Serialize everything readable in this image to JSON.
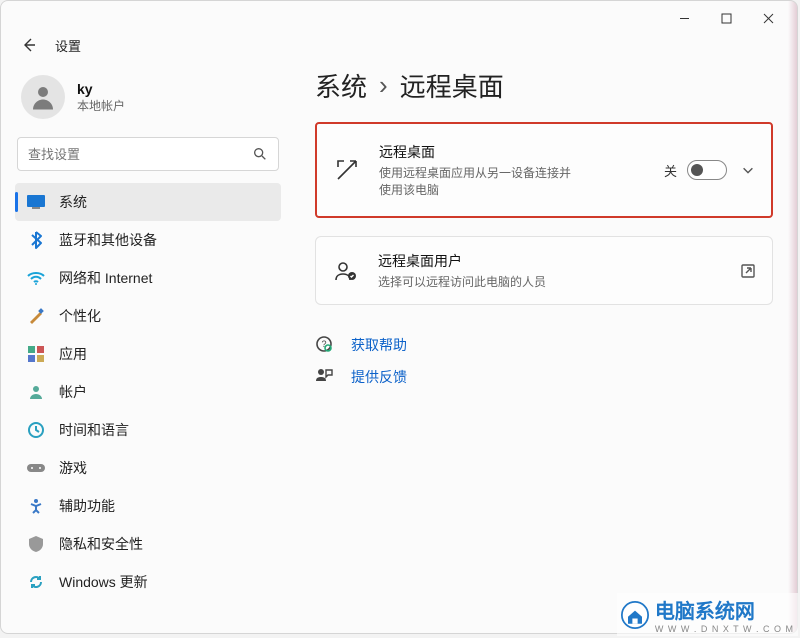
{
  "app_title": "设置",
  "user": {
    "name": "ky",
    "subtitle": "本地帐户"
  },
  "search": {
    "placeholder": "查找设置"
  },
  "nav": {
    "items": [
      {
        "label": "系统",
        "icon": "system"
      },
      {
        "label": "蓝牙和其他设备",
        "icon": "bluetooth"
      },
      {
        "label": "网络和 Internet",
        "icon": "wifi"
      },
      {
        "label": "个性化",
        "icon": "personalize"
      },
      {
        "label": "应用",
        "icon": "apps"
      },
      {
        "label": "帐户",
        "icon": "account"
      },
      {
        "label": "时间和语言",
        "icon": "time"
      },
      {
        "label": "游戏",
        "icon": "game"
      },
      {
        "label": "辅助功能",
        "icon": "accessibility"
      },
      {
        "label": "隐私和安全性",
        "icon": "privacy"
      },
      {
        "label": "Windows 更新",
        "icon": "update"
      }
    ],
    "active_index": 0
  },
  "breadcrumb": {
    "parent": "系统",
    "current": "远程桌面"
  },
  "cards": {
    "remote_desktop": {
      "title": "远程桌面",
      "subtitle": "使用远程桌面应用从另一设备连接并使用该电脑",
      "toggle_label": "关"
    },
    "remote_users": {
      "title": "远程桌面用户",
      "subtitle": "选择可以远程访问此电脑的人员"
    }
  },
  "links": {
    "help": "获取帮助",
    "feedback": "提供反馈"
  },
  "watermark": {
    "brand": "电脑系统网",
    "url": "W W W . D N X T W . C O M"
  }
}
